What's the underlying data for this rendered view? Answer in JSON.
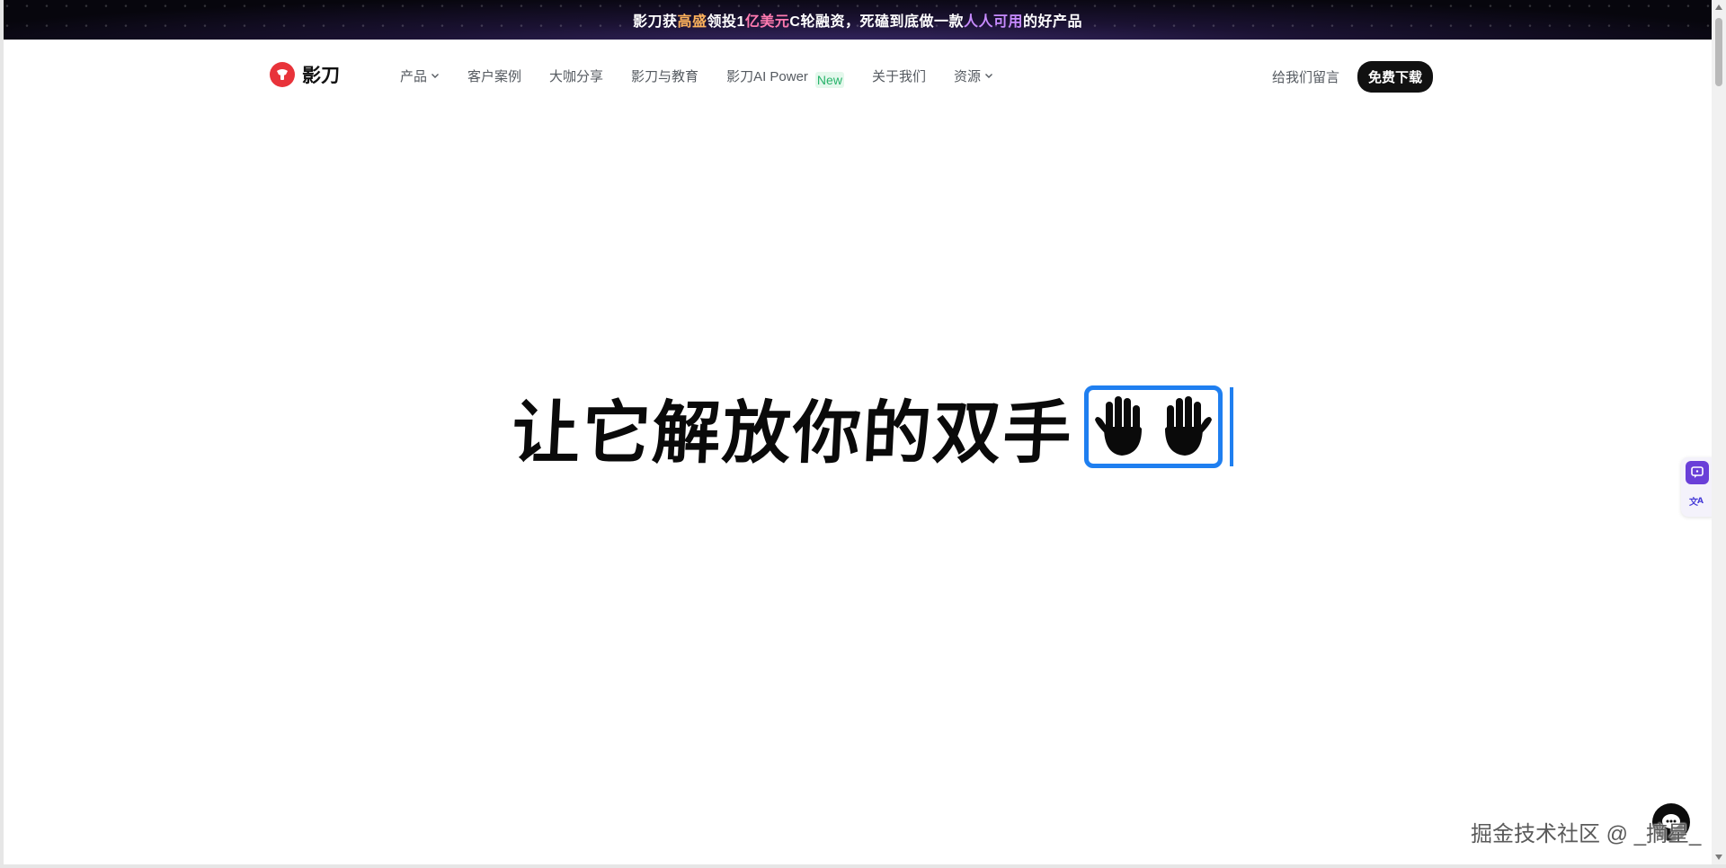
{
  "banner": {
    "seg1": "影刀获",
    "seg2": "高盛",
    "seg3": "领投1",
    "seg4": "亿美元",
    "seg5": "C轮融资，死磕到底做一款",
    "seg6": "人人可用",
    "seg7": "的好产品"
  },
  "nav": {
    "logo_text": "影刀",
    "menu": [
      {
        "label": "产品",
        "dropdown": true
      },
      {
        "label": "客户案例",
        "dropdown": false
      },
      {
        "label": "大咖分享",
        "dropdown": false
      },
      {
        "label": "影刀与教育",
        "dropdown": false
      },
      {
        "label": "影刀AI Power",
        "dropdown": false,
        "badge": "New"
      },
      {
        "label": "关于我们",
        "dropdown": false
      },
      {
        "label": "资源",
        "dropdown": true
      }
    ],
    "message_link": "给我们留言",
    "download_button": "免费下载"
  },
  "hero": {
    "title": "让它解放你的双手",
    "emoji_icon": "raised-hands-icon"
  },
  "side_tools": [
    {
      "icon": "chat-bubble-icon"
    },
    {
      "icon": "translate-icon"
    }
  ],
  "watermark": "掘金技术社区 @ _摘星_",
  "colors": {
    "accent_blue": "#1f7ff0",
    "brand_red": "#e8333a",
    "new_badge_green": "#27b36a",
    "tool_purple": "#6a3fd8"
  }
}
